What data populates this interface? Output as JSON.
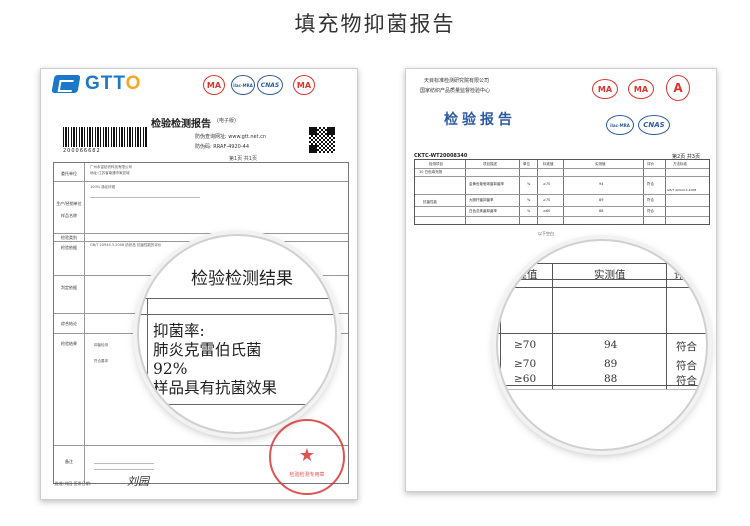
{
  "page": {
    "title": "填充物抑菌报告"
  },
  "left_report": {
    "brand": {
      "letters": "GTT",
      "last_letter": "O"
    },
    "certs": [
      "MA",
      "ilac-MRA",
      "CNAS",
      "MA"
    ],
    "title": "检验检测报告",
    "title_sub": "(电子版)",
    "meta": [
      "防伪查询网址: www.gtt.net.cn",
      "防伪码: RRAF-4920-44"
    ],
    "page_indicator": "第1页  共1页",
    "barcode_number": "200066682",
    "labels": [
      "委托单位",
      "生产/经销单位",
      "样品名称",
      "检验类别",
      "检验依据",
      "判定依据",
      "综合结论",
      "检验结果",
      "备注"
    ],
    "client_text": "广州永富纺织科技有限公司",
    "address_text": "地址:江苏省南通市家纺城",
    "standard_text": "GB/T 20944.3-2008 纺织品 抗菌性能的评价",
    "row_texts": [
      "100% 涤纶纤维",
      "抑菌检测",
      "符合要求"
    ],
    "magnifier": {
      "heading": "检验检测结果",
      "lines": [
        "抑菌率:",
        "肺炎克雷伯氏菌",
        "92%",
        "样品具有抗菌效果"
      ]
    },
    "stamp": {
      "text": "检验检测专用章"
    },
    "footer": "批准:刘园   签发日期:",
    "signature": "刘园"
  },
  "right_report": {
    "header_lines": [
      "天目标准检测研究院有限公司",
      "国家纺织产品质量监督检验中心"
    ],
    "certs": [
      "MA",
      "MA",
      "A",
      "ilac-MRA",
      "CNAS"
    ],
    "title": "检验报告",
    "report_number": "CKTC-WT20008340",
    "page_indicator": "第2页 共3页",
    "table": {
      "headers": [
        "检测项目",
        "项目描述",
        "单位",
        "标准值",
        "实测值",
        "评价",
        "方法标准"
      ],
      "rows": [
        {
          "item": "抗菌性能",
          "desc": "金黄色葡萄球菌抑菌率",
          "unit": "%",
          "std": "≥70",
          "val": "94",
          "eval": "符合"
        },
        {
          "item": "",
          "desc": "大肠杆菌抑菌率",
          "unit": "%",
          "std": "≥70",
          "val": "89",
          "eval": "符合"
        },
        {
          "item": "",
          "desc": "白色念珠菌抑菌率",
          "unit": "%",
          "std": "≥60",
          "val": "88",
          "eval": "符合"
        }
      ],
      "method": "GB/T 20944.3-2008",
      "first_row": "10  白色填充物"
    },
    "caption": "以下空白",
    "magnifier": {
      "headers": [
        "标准值",
        "实测值",
        "评价"
      ],
      "rows": [
        {
          "std": "≥70",
          "val": "94",
          "eval": "符合"
        },
        {
          "std": "≥70",
          "val": "89",
          "eval": "符合"
        },
        {
          "std": "≥60",
          "val": "88",
          "eval": "符合"
        }
      ]
    }
  }
}
